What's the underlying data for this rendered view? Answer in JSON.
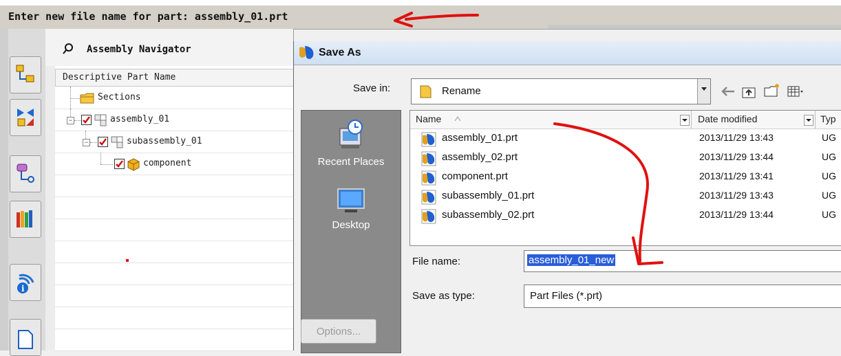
{
  "prompt": {
    "text": "Enter new file name for part: assembly_01.prt"
  },
  "navigator": {
    "title": "Assembly Navigator",
    "column_header": "Descriptive Part Name",
    "tree": [
      {
        "label": "Sections",
        "level": 0,
        "type": "folder"
      },
      {
        "label": "assembly_01",
        "level": 0,
        "type": "assembly",
        "checked": true,
        "expanded": true
      },
      {
        "label": "subassembly_01",
        "level": 1,
        "type": "assembly",
        "checked": true,
        "expanded": true
      },
      {
        "label": "component",
        "level": 2,
        "type": "part",
        "checked": true
      }
    ]
  },
  "dialog": {
    "title": "Save As",
    "save_in_label": "Save in:",
    "save_in_value": "Rename",
    "places": [
      {
        "label": "Recent Places",
        "icon": "recent-places-icon"
      },
      {
        "label": "Desktop",
        "icon": "desktop-icon"
      }
    ],
    "columns": {
      "name": "Name",
      "date": "Date modified",
      "type": "Typ"
    },
    "files": [
      {
        "name": "assembly_01.prt",
        "date": "2013/11/29 13:43",
        "type": "UG"
      },
      {
        "name": "assembly_02.prt",
        "date": "2013/11/29 13:44",
        "type": "UG"
      },
      {
        "name": "component.prt",
        "date": "2013/11/29 13:41",
        "type": "UG"
      },
      {
        "name": "subassembly_01.prt",
        "date": "2013/11/29 13:43",
        "type": "UG"
      },
      {
        "name": "subassembly_02.prt",
        "date": "2013/11/29 13:44",
        "type": "UG"
      }
    ],
    "file_name_label": "File name:",
    "file_name_value": "assembly_01_new",
    "save_as_type_label": "Save as type:",
    "save_as_type_value": "Part Files (*.prt)",
    "options_label": "Options..."
  },
  "colors": {
    "selection": "#2a5ed8",
    "annotation": "#e01010",
    "places_panel": "#8a8a8a"
  }
}
